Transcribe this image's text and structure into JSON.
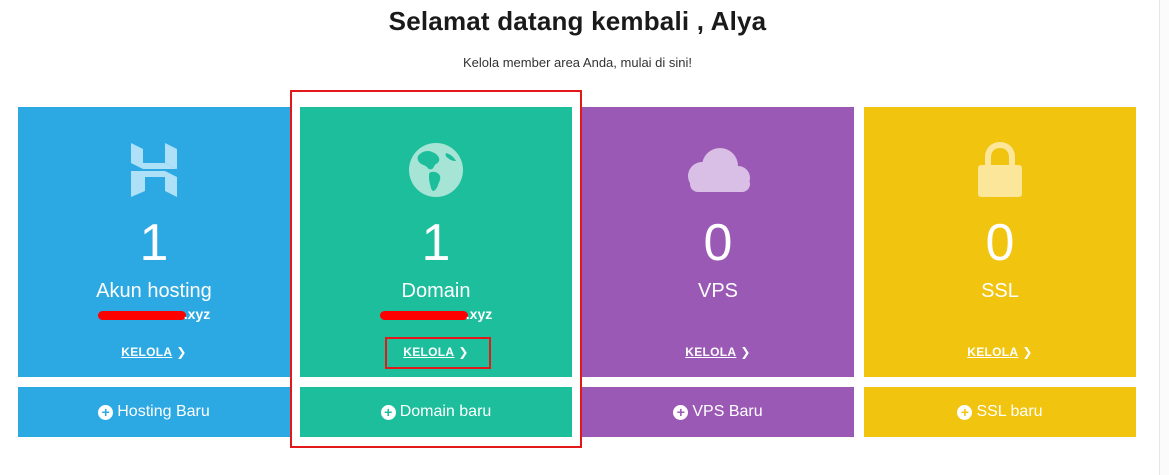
{
  "header": {
    "title": "Selamat datang kembali , Alya",
    "subtitle": "Kelola member area Anda, mulai di sini!"
  },
  "cards": [
    {
      "id": "hosting",
      "icon": "hostinger-logo-icon",
      "count": "1",
      "label": "Akun hosting",
      "detail_suffix": ".xyz",
      "manage_label": "KELOLA",
      "new_label": "Hosting Baru",
      "color": "#2ca8e3"
    },
    {
      "id": "domain",
      "icon": "globe-icon",
      "count": "1",
      "label": "Domain",
      "detail_suffix": ".xyz",
      "manage_label": "KELOLA",
      "new_label": "Domain baru",
      "color": "#1cbe9b"
    },
    {
      "id": "vps",
      "icon": "cloud-icon",
      "count": "0",
      "label": "VPS",
      "manage_label": "KELOLA",
      "new_label": "VPS Baru",
      "color": "#9b59b6"
    },
    {
      "id": "ssl",
      "icon": "padlock-icon",
      "count": "0",
      "label": "SSL",
      "manage_label": "KELOLA",
      "new_label": "SSL baru",
      "color": "#f1c40f"
    }
  ],
  "annotations": {
    "highlight_color": "#e31818"
  }
}
